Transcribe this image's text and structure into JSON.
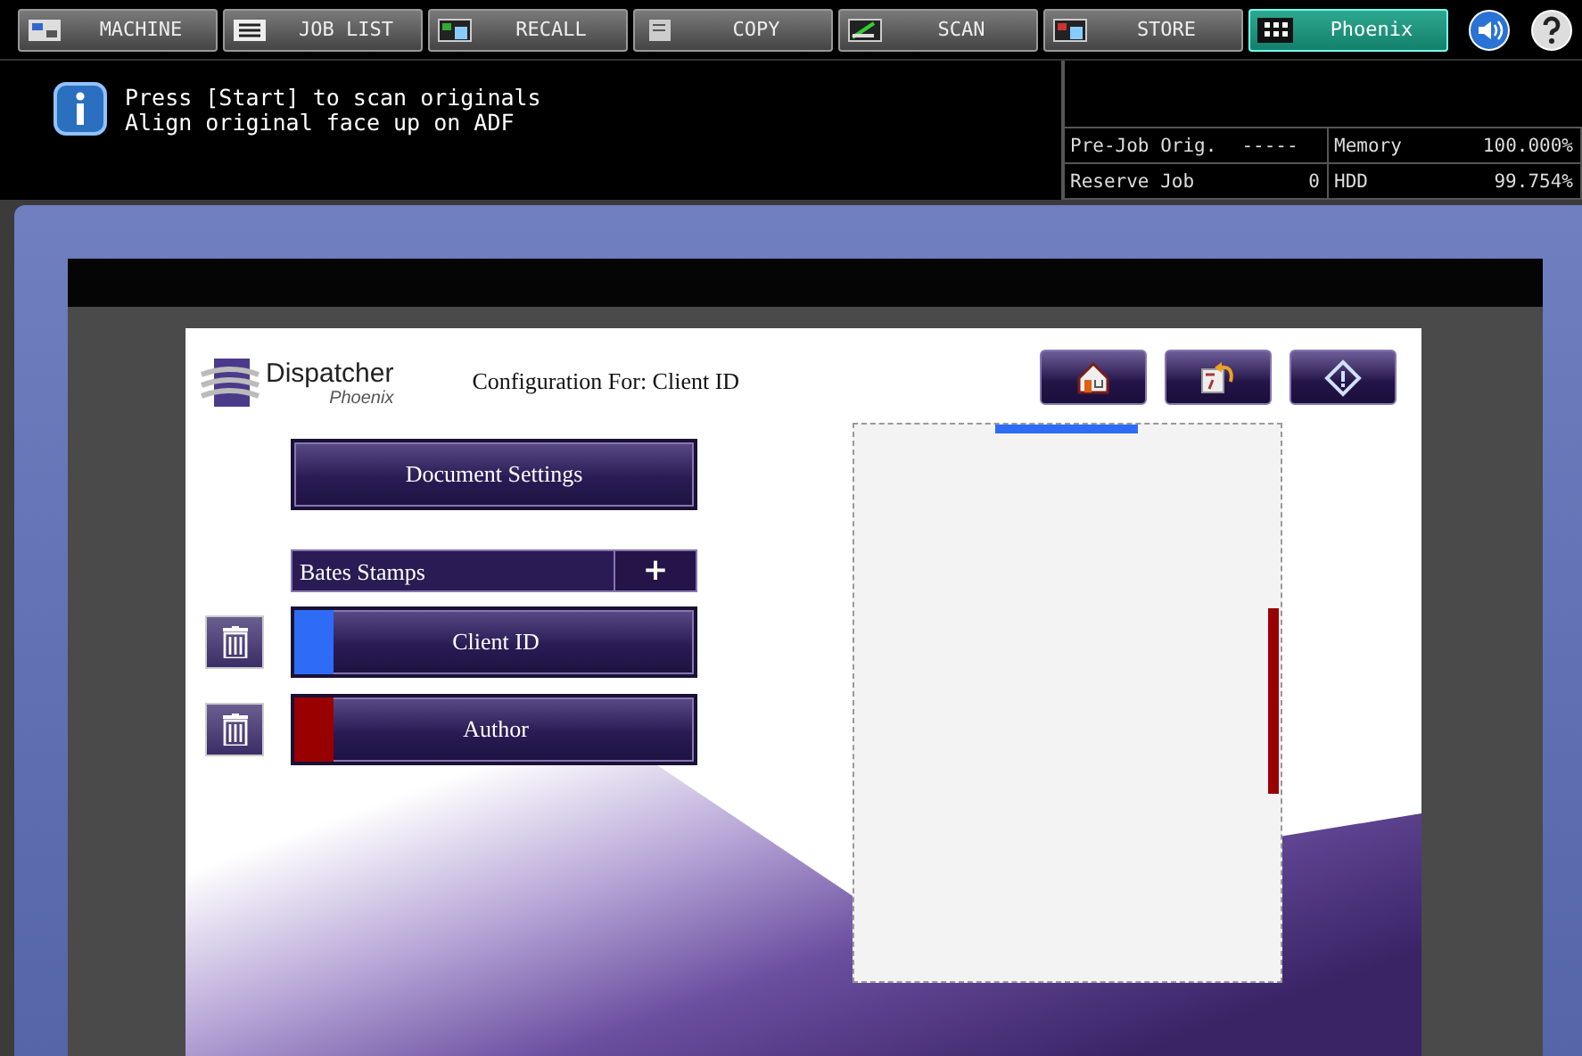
{
  "tabs": [
    {
      "label": "MACHINE",
      "kind": "machine",
      "selected": false
    },
    {
      "label": "JOB LIST",
      "kind": "list",
      "selected": false
    },
    {
      "label": "RECALL",
      "kind": "recall",
      "selected": false
    },
    {
      "label": "COPY",
      "kind": "copy",
      "selected": false
    },
    {
      "label": "SCAN",
      "kind": "scan",
      "selected": false
    },
    {
      "label": "STORE",
      "kind": "store",
      "selected": false
    },
    {
      "label": "Phoenix",
      "kind": "grid",
      "selected": true
    }
  ],
  "message": {
    "lines": [
      "Press [Start] to scan originals",
      "Align original face up on ADF"
    ]
  },
  "status": [
    {
      "label": "Pre-Job Orig.",
      "value": "-----"
    },
    {
      "label": "Memory",
      "value": "100.000%"
    },
    {
      "label": "Reserve Job",
      "value": "0"
    },
    {
      "label": "HDD",
      "value": "99.754%"
    }
  ],
  "app": {
    "logo": {
      "name": "Dispatcher",
      "sub": "Phoenix"
    },
    "config_title": "Configuration For: Client ID",
    "toolbar": [
      {
        "kind": "home"
      },
      {
        "kind": "back"
      },
      {
        "kind": "start"
      }
    ],
    "document_settings": "Document Settings",
    "section": "Bates Stamps",
    "add_symbol": "+",
    "stamps": [
      {
        "label": "Client ID",
        "color": "#2f6cf6",
        "kind": "top"
      },
      {
        "label": "Author",
        "color": "#990000",
        "kind": "right"
      }
    ]
  }
}
